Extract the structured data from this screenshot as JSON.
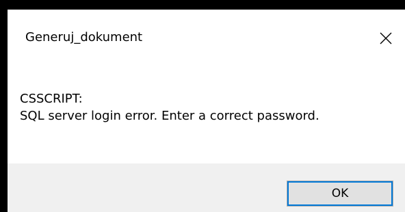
{
  "window": {
    "title": "Generuj_dokument",
    "close_icon": "close-icon"
  },
  "message": {
    "line1": "CSSCRIPT:",
    "line2": "SQL server login error. Enter a correct password."
  },
  "buttons": {
    "ok_label": "OK"
  },
  "colors": {
    "dialog_bg": "#ffffff",
    "footer_bg": "#f0f0f0",
    "button_bg": "#e1e1e1",
    "focus_border": "#0078d7"
  }
}
